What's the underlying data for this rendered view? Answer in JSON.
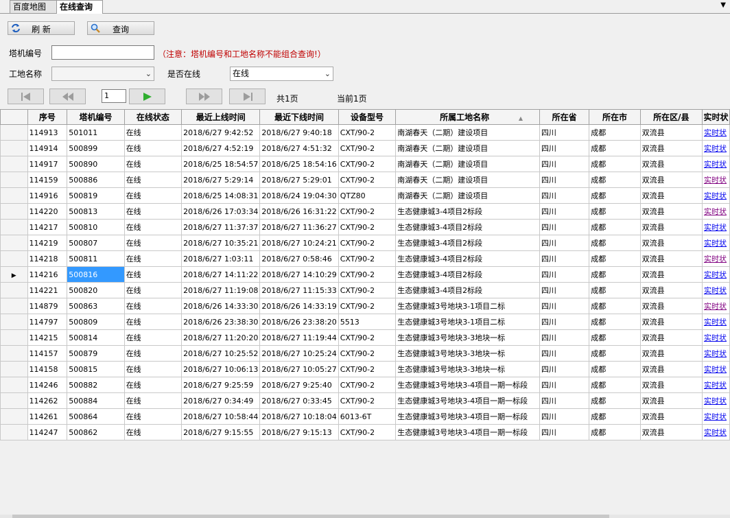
{
  "tabs": [
    {
      "label": "百度地图",
      "active": false
    },
    {
      "label": "在线查询",
      "active": true
    }
  ],
  "toolbar": {
    "refresh_label": "刷  新",
    "query_label": "查询"
  },
  "form": {
    "tower_no_label": "塔机编号",
    "tower_no_value": "",
    "note": "（注意：塔机编号和工地名称不能组合查询!）",
    "site_label": "工地名称",
    "site_value": "",
    "online_label": "是否在线",
    "online_value": "在线"
  },
  "pager": {
    "page_input": "1",
    "total_pages": "共1页",
    "current_page": "当前1页"
  },
  "grid": {
    "columns": [
      "序号",
      "塔机编号",
      "在线状态",
      "最近上线时间",
      "最近下线时间",
      "设备型号",
      "所属工地名称",
      "所在省",
      "所在市",
      "所在区/县",
      "实时状"
    ],
    "sort_column": "所属工地名称",
    "selected_row": 9,
    "rows": [
      {
        "id": "114913",
        "tower": "501011",
        "status": "在线",
        "up": "2018/6/27 9:42:52",
        "down": "2018/6/27 9:40:18",
        "model": "CXT/90-2",
        "site": "南湖春天（二期）建设项目",
        "prov": "四川",
        "city": "成都",
        "county": "双流县",
        "link": "实时状",
        "visited": false
      },
      {
        "id": "114914",
        "tower": "500899",
        "status": "在线",
        "up": "2018/6/27 4:52:19",
        "down": "2018/6/27 4:51:32",
        "model": "CXT/90-2",
        "site": "南湖春天（二期）建设项目",
        "prov": "四川",
        "city": "成都",
        "county": "双流县",
        "link": "实时状",
        "visited": false
      },
      {
        "id": "114917",
        "tower": "500890",
        "status": "在线",
        "up": "2018/6/25 18:54:57",
        "down": "2018/6/25 18:54:16",
        "model": "CXT/90-2",
        "site": "南湖春天（二期）建设项目",
        "prov": "四川",
        "city": "成都",
        "county": "双流县",
        "link": "实时状",
        "visited": false
      },
      {
        "id": "114159",
        "tower": "500886",
        "status": "在线",
        "up": "2018/6/27 5:29:14",
        "down": "2018/6/27 5:29:01",
        "model": "CXT/90-2",
        "site": "南湖春天（二期）建设项目",
        "prov": "四川",
        "city": "成都",
        "county": "双流县",
        "link": "实时状",
        "visited": true
      },
      {
        "id": "114916",
        "tower": "500819",
        "status": "在线",
        "up": "2018/6/25 14:08:31",
        "down": "2018/6/24 19:04:30",
        "model": "QTZ80",
        "site": "南湖春天（二期）建设项目",
        "prov": "四川",
        "city": "成都",
        "county": "双流县",
        "link": "实时状",
        "visited": false
      },
      {
        "id": "114220",
        "tower": "500813",
        "status": "在线",
        "up": "2018/6/26 17:03:34",
        "down": "2018/6/26 16:31:22",
        "model": "CXT/90-2",
        "site": "生态健康城3-4项目2标段",
        "prov": "四川",
        "city": "成都",
        "county": "双流县",
        "link": "实时状",
        "visited": true
      },
      {
        "id": "114217",
        "tower": "500810",
        "status": "在线",
        "up": "2018/6/27 11:37:37",
        "down": "2018/6/27 11:36:27",
        "model": "CXT/90-2",
        "site": "生态健康城3-4项目2标段",
        "prov": "四川",
        "city": "成都",
        "county": "双流县",
        "link": "实时状",
        "visited": false
      },
      {
        "id": "114219",
        "tower": "500807",
        "status": "在线",
        "up": "2018/6/27 10:35:21",
        "down": "2018/6/27 10:24:21",
        "model": "CXT/90-2",
        "site": "生态健康城3-4项目2标段",
        "prov": "四川",
        "city": "成都",
        "county": "双流县",
        "link": "实时状",
        "visited": false
      },
      {
        "id": "114218",
        "tower": "500811",
        "status": "在线",
        "up": "2018/6/27 1:03:11",
        "down": "2018/6/27 0:58:46",
        "model": "CXT/90-2",
        "site": "生态健康城3-4项目2标段",
        "prov": "四川",
        "city": "成都",
        "county": "双流县",
        "link": "实时状",
        "visited": true
      },
      {
        "id": "114216",
        "tower": "500816",
        "status": "在线",
        "up": "2018/6/27 14:11:22",
        "down": "2018/6/27 14:10:29",
        "model": "CXT/90-2",
        "site": "生态健康城3-4项目2标段",
        "prov": "四川",
        "city": "成都",
        "county": "双流县",
        "link": "实时状",
        "visited": false
      },
      {
        "id": "114221",
        "tower": "500820",
        "status": "在线",
        "up": "2018/6/27 11:19:08",
        "down": "2018/6/27 11:15:33",
        "model": "CXT/90-2",
        "site": "生态健康城3-4项目2标段",
        "prov": "四川",
        "city": "成都",
        "county": "双流县",
        "link": "实时状",
        "visited": false
      },
      {
        "id": "114879",
        "tower": "500863",
        "status": "在线",
        "up": "2018/6/26 14:33:30",
        "down": "2018/6/26 14:33:19",
        "model": "CXT/90-2",
        "site": "生态健康城3号地块3-1项目二标",
        "prov": "四川",
        "city": "成都",
        "county": "双流县",
        "link": "实时状",
        "visited": true
      },
      {
        "id": "114797",
        "tower": "500809",
        "status": "在线",
        "up": "2018/6/26 23:38:30",
        "down": "2018/6/26 23:38:20",
        "model": "5513",
        "site": "生态健康城3号地块3-1项目二标",
        "prov": "四川",
        "city": "成都",
        "county": "双流县",
        "link": "实时状",
        "visited": false
      },
      {
        "id": "114215",
        "tower": "500814",
        "status": "在线",
        "up": "2018/6/27 11:20:20",
        "down": "2018/6/27 11:19:44",
        "model": "CXT/90-2",
        "site": "生态健康城3号地块3-3地块一标",
        "prov": "四川",
        "city": "成都",
        "county": "双流县",
        "link": "实时状",
        "visited": false
      },
      {
        "id": "114157",
        "tower": "500879",
        "status": "在线",
        "up": "2018/6/27 10:25:52",
        "down": "2018/6/27 10:25:24",
        "model": "CXT/90-2",
        "site": "生态健康城3号地块3-3地块一标",
        "prov": "四川",
        "city": "成都",
        "county": "双流县",
        "link": "实时状",
        "visited": false
      },
      {
        "id": "114158",
        "tower": "500815",
        "status": "在线",
        "up": "2018/6/27 10:06:13",
        "down": "2018/6/27 10:05:27",
        "model": "CXT/90-2",
        "site": "生态健康城3号地块3-3地块一标",
        "prov": "四川",
        "city": "成都",
        "county": "双流县",
        "link": "实时状",
        "visited": false
      },
      {
        "id": "114246",
        "tower": "500882",
        "status": "在线",
        "up": "2018/6/27 9:25:59",
        "down": "2018/6/27 9:25:40",
        "model": "CXT/90-2",
        "site": "生态健康城3号地块3-4项目一期一标段",
        "prov": "四川",
        "city": "成都",
        "county": "双流县",
        "link": "实时状",
        "visited": false
      },
      {
        "id": "114262",
        "tower": "500884",
        "status": "在线",
        "up": "2018/6/27 0:34:49",
        "down": "2018/6/27 0:33:45",
        "model": "CXT/90-2",
        "site": "生态健康城3号地块3-4项目一期一标段",
        "prov": "四川",
        "city": "成都",
        "county": "双流县",
        "link": "实时状",
        "visited": false
      },
      {
        "id": "114261",
        "tower": "500864",
        "status": "在线",
        "up": "2018/6/27 10:58:44",
        "down": "2018/6/27 10:18:04",
        "model": "6013-6T",
        "site": "生态健康城3号地块3-4项目一期一标段",
        "prov": "四川",
        "city": "成都",
        "county": "双流县",
        "link": "实时状",
        "visited": false
      },
      {
        "id": "114247",
        "tower": "500862",
        "status": "在线",
        "up": "2018/6/27 9:15:55",
        "down": "2018/6/27 9:15:13",
        "model": "CXT/90-2",
        "site": "生态健康城3号地块3-4项目一期一标段",
        "prov": "四川",
        "city": "成都",
        "county": "双流县",
        "link": "实时状",
        "visited": false
      }
    ]
  }
}
